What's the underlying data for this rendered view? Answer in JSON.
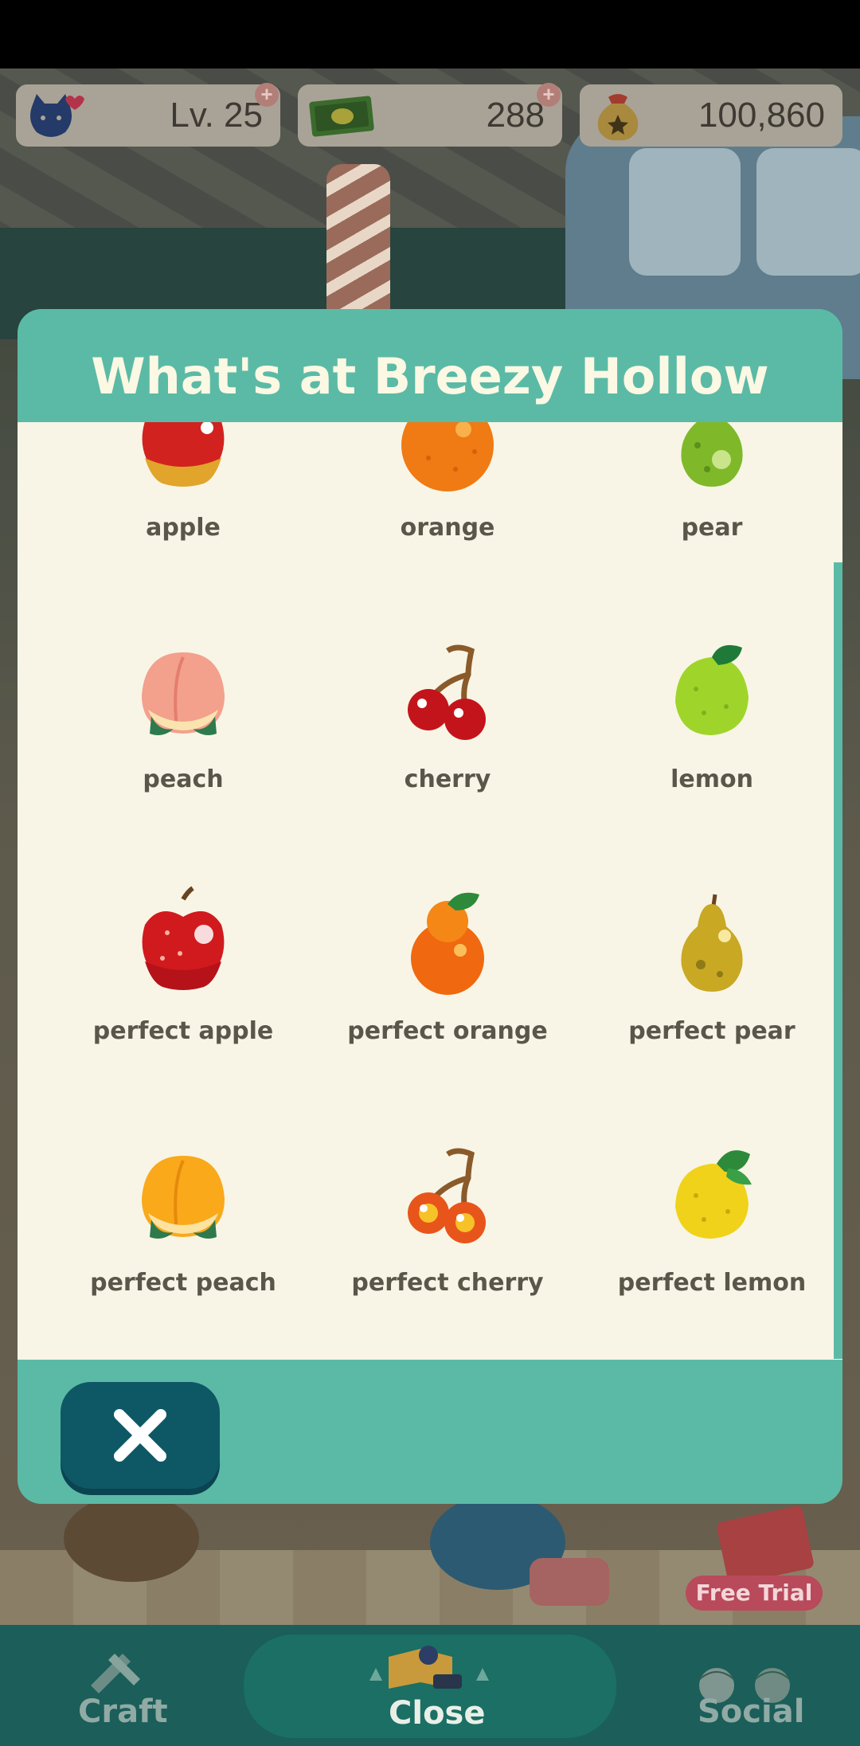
{
  "status": {
    "level_label": "Lv. 25",
    "tickets": "288",
    "bells": "100,860"
  },
  "modal": {
    "title": "What's at Breezy Hollow",
    "items": [
      {
        "label": "apple",
        "icon": "apple-icon"
      },
      {
        "label": "orange",
        "icon": "orange-icon"
      },
      {
        "label": "pear",
        "icon": "pear-icon"
      },
      {
        "label": "peach",
        "icon": "peach-icon"
      },
      {
        "label": "cherry",
        "icon": "cherry-icon"
      },
      {
        "label": "lemon",
        "icon": "lemon-icon"
      },
      {
        "label": "perfect apple",
        "icon": "perfect-apple-icon"
      },
      {
        "label": "perfect orange",
        "icon": "perfect-orange-icon"
      },
      {
        "label": "perfect pear",
        "icon": "perfect-pear-icon"
      },
      {
        "label": "perfect peach",
        "icon": "perfect-peach-icon"
      },
      {
        "label": "perfect cherry",
        "icon": "perfect-cherry-icon"
      },
      {
        "label": "perfect lemon",
        "icon": "perfect-lemon-icon"
      }
    ],
    "close_icon": "close-icon"
  },
  "badge": {
    "free_trial": "Free Trial"
  },
  "nav": {
    "craft": "Craft",
    "close": "Close",
    "social": "Social"
  },
  "colors": {
    "modal_teal": "#5bbaa6",
    "modal_body": "#f8f5e6",
    "close_button": "#0e5866",
    "nav_bar": "#1b5e5a"
  }
}
